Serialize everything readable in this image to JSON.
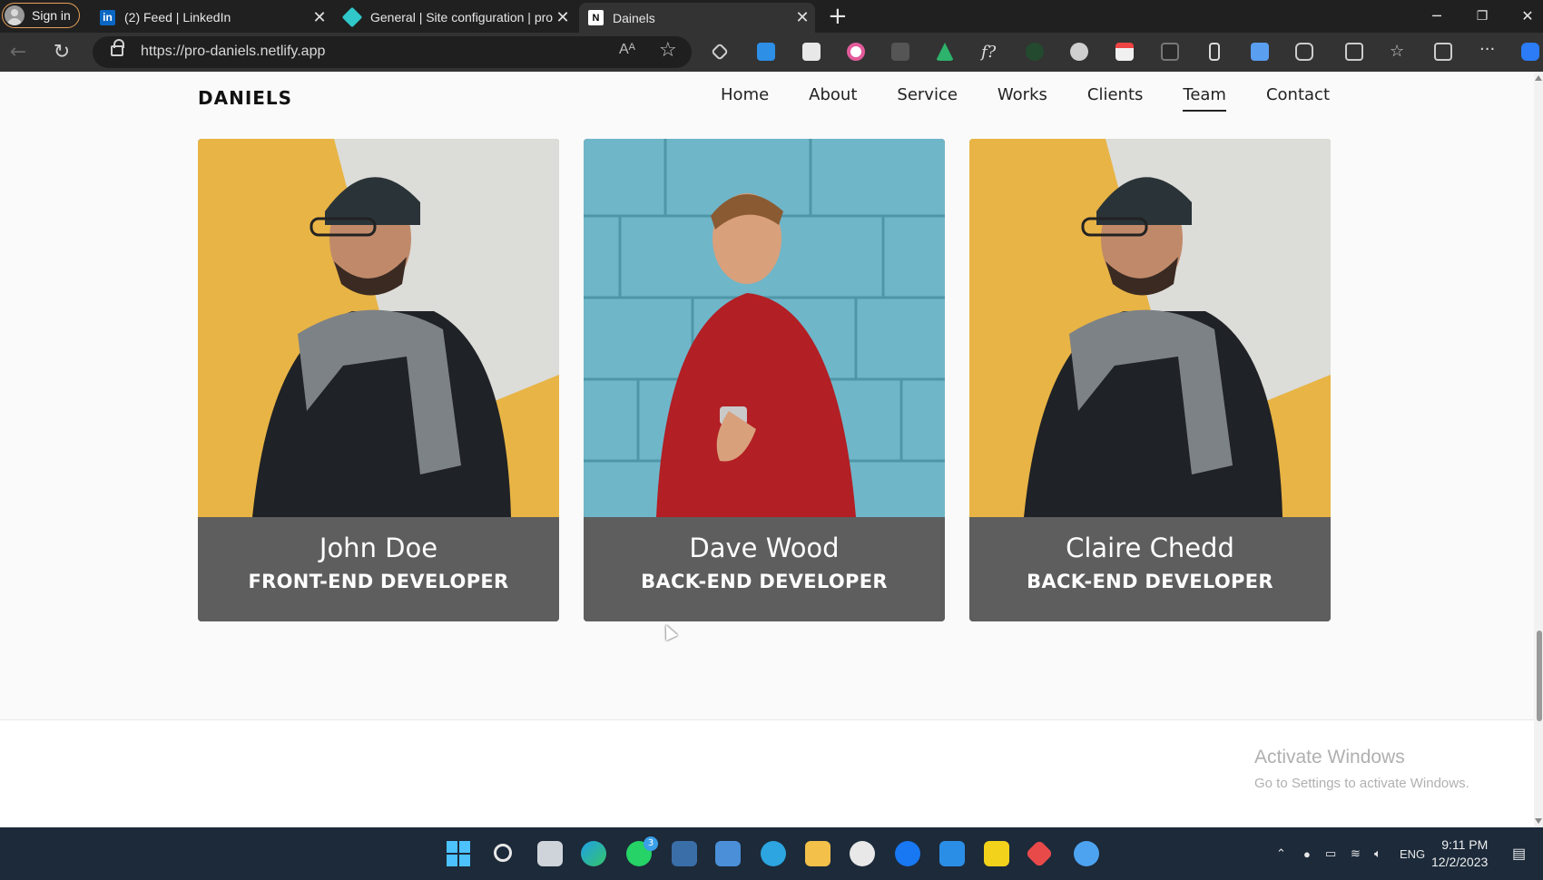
{
  "browser": {
    "profile_label": "Sign in",
    "tabs": [
      {
        "title": "(2) Feed | LinkedIn",
        "icon": "linkedin-icon",
        "active": false
      },
      {
        "title": "General | Site configuration | pro",
        "icon": "netlify-icon",
        "active": false
      },
      {
        "title": "Dainels",
        "icon": "notion-icon",
        "active": true
      }
    ],
    "url": "https://pro-daniels.netlify.app",
    "read_aloud_label": "Aᴬ"
  },
  "site": {
    "logo": "DANIELS",
    "nav": [
      {
        "label": "Home",
        "active": false
      },
      {
        "label": "About",
        "active": false
      },
      {
        "label": "Service",
        "active": false
      },
      {
        "label": "Works",
        "active": false
      },
      {
        "label": "Clients",
        "active": false
      },
      {
        "label": "Team",
        "active": true
      },
      {
        "label": "Contact",
        "active": false
      }
    ],
    "team": [
      {
        "name": "John Doe",
        "role": "FRONT-END DEVELOPER",
        "photo": "man-scarf-beanie-photo"
      },
      {
        "name": "Dave Wood",
        "role": "BACK-END DEVELOPER",
        "photo": "man-red-sweater-photo"
      },
      {
        "name": "Claire Chedd",
        "role": "BACK-END DEVELOPER",
        "photo": "man-scarf-beanie-photo"
      }
    ]
  },
  "watermark": {
    "title": "Activate Windows",
    "subtitle": "Go to Settings to activate Windows."
  },
  "taskbar": {
    "language": "ENG",
    "time": "9:11 PM",
    "date": "12/2/2023",
    "whatsapp_badge": "3"
  },
  "colors": {
    "card_caption": "#5e5e5e",
    "page_bg": "#fafafa",
    "accent_start": "#4cc2ff"
  }
}
